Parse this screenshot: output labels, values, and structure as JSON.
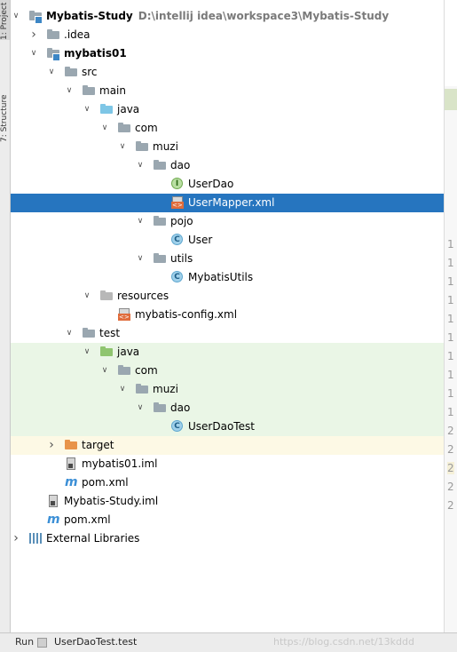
{
  "side_tabs": {
    "project": "1: Project",
    "structure": "7: Structure"
  },
  "tree": [
    {
      "label": "Mybatis-Study",
      "path": "D:\\intellij idea\\workspace3\\Mybatis-Study",
      "bold": true,
      "icon": "module-folder-icon",
      "arrow": "down"
    },
    {
      "label": ".idea",
      "icon": "folder-icon",
      "arrow": "right"
    },
    {
      "label": "mybatis01",
      "bold": true,
      "icon": "module-folder-icon",
      "arrow": "down"
    },
    {
      "label": "src",
      "icon": "folder-icon",
      "arrow": "down"
    },
    {
      "label": "main",
      "icon": "folder-icon",
      "arrow": "down"
    },
    {
      "label": "java",
      "icon": "source-folder-icon",
      "arrow": "down"
    },
    {
      "label": "com",
      "icon": "package-icon",
      "arrow": "down"
    },
    {
      "label": "muzi",
      "icon": "package-icon",
      "arrow": "down"
    },
    {
      "label": "dao",
      "icon": "package-icon",
      "arrow": "down"
    },
    {
      "label": "UserDao",
      "icon": "interface-icon"
    },
    {
      "label": "UserMapper.xml",
      "icon": "xml-file-icon",
      "selected": true
    },
    {
      "label": "pojo",
      "icon": "package-icon",
      "arrow": "down"
    },
    {
      "label": "User",
      "icon": "class-icon"
    },
    {
      "label": "utils",
      "icon": "package-icon",
      "arrow": "down"
    },
    {
      "label": "MybatisUtils",
      "icon": "class-icon"
    },
    {
      "label": "resources",
      "icon": "resources-folder-icon",
      "arrow": "down"
    },
    {
      "label": "mybatis-config.xml",
      "icon": "xml-file-icon"
    },
    {
      "label": "test",
      "icon": "folder-icon",
      "arrow": "down"
    },
    {
      "label": "java",
      "icon": "test-folder-icon",
      "arrow": "down",
      "bg": "test"
    },
    {
      "label": "com",
      "icon": "package-icon",
      "arrow": "down",
      "bg": "test"
    },
    {
      "label": "muzi",
      "icon": "package-icon",
      "arrow": "down",
      "bg": "test"
    },
    {
      "label": "dao",
      "icon": "package-icon",
      "arrow": "down",
      "bg": "test"
    },
    {
      "label": "UserDaoTest",
      "icon": "test-class-icon",
      "bg": "test"
    },
    {
      "label": "target",
      "icon": "excluded-folder-icon",
      "arrow": "right",
      "bg": "excluded"
    },
    {
      "label": "mybatis01.iml",
      "icon": "iml-file-icon"
    },
    {
      "label": "pom.xml",
      "icon": "maven-icon"
    },
    {
      "label": "Mybatis-Study.iml",
      "icon": "iml-file-icon"
    },
    {
      "label": "pom.xml",
      "icon": "maven-icon"
    },
    {
      "label": "External Libraries",
      "icon": "libraries-icon",
      "arrow": "right"
    }
  ],
  "gutter_numbers": [
    "1",
    "1",
    "1",
    "1",
    "1",
    "1",
    "1",
    "1",
    "1",
    "1",
    "2",
    "2",
    "2",
    "2",
    "2"
  ],
  "bottom_bar": {
    "run_label": "Run",
    "run_config": "UserDaoTest.test"
  },
  "watermark": "https://blog.csdn.net/13kddd"
}
